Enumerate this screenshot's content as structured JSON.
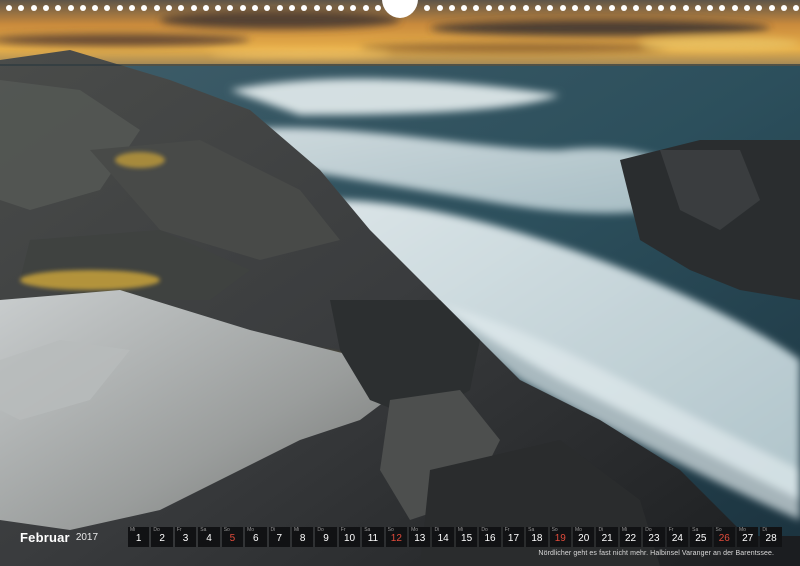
{
  "calendar": {
    "month": "Februar",
    "year": "2017",
    "days": [
      {
        "n": "1",
        "d": "Mi",
        "weekend": false
      },
      {
        "n": "2",
        "d": "Do",
        "weekend": false
      },
      {
        "n": "3",
        "d": "Fr",
        "weekend": false
      },
      {
        "n": "4",
        "d": "Sa",
        "weekend": false
      },
      {
        "n": "5",
        "d": "So",
        "weekend": true
      },
      {
        "n": "6",
        "d": "Mo",
        "weekend": false
      },
      {
        "n": "7",
        "d": "Di",
        "weekend": false
      },
      {
        "n": "8",
        "d": "Mi",
        "weekend": false
      },
      {
        "n": "9",
        "d": "Do",
        "weekend": false
      },
      {
        "n": "10",
        "d": "Fr",
        "weekend": false
      },
      {
        "n": "11",
        "d": "Sa",
        "weekend": false
      },
      {
        "n": "12",
        "d": "So",
        "weekend": true
      },
      {
        "n": "13",
        "d": "Mo",
        "weekend": false
      },
      {
        "n": "14",
        "d": "Di",
        "weekend": false
      },
      {
        "n": "15",
        "d": "Mi",
        "weekend": false
      },
      {
        "n": "16",
        "d": "Do",
        "weekend": false
      },
      {
        "n": "17",
        "d": "Fr",
        "weekend": false
      },
      {
        "n": "18",
        "d": "Sa",
        "weekend": false
      },
      {
        "n": "19",
        "d": "So",
        "weekend": true
      },
      {
        "n": "20",
        "d": "Mo",
        "weekend": false
      },
      {
        "n": "21",
        "d": "Di",
        "weekend": false
      },
      {
        "n": "22",
        "d": "Mi",
        "weekend": false
      },
      {
        "n": "23",
        "d": "Do",
        "weekend": false
      },
      {
        "n": "24",
        "d": "Fr",
        "weekend": false
      },
      {
        "n": "25",
        "d": "Sa",
        "weekend": false
      },
      {
        "n": "26",
        "d": "So",
        "weekend": true
      },
      {
        "n": "27",
        "d": "Mo",
        "weekend": false
      },
      {
        "n": "28",
        "d": "Di",
        "weekend": false
      }
    ]
  },
  "caption": "Nördlicher geht es fast nicht mehr. Halbinsel Varanger an der Barentssee.",
  "colors": {
    "weekend": "#e14b3b",
    "day_cell": "#111214",
    "sky_glow": "#e8a93f",
    "sea": "#2e4f5e"
  }
}
